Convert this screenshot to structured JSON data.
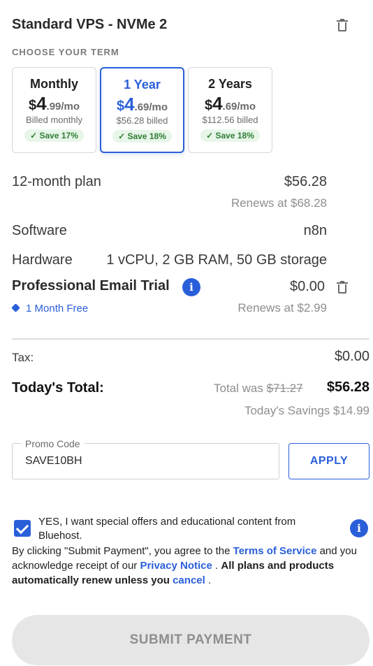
{
  "product": {
    "title": "Standard VPS - NVMe 2"
  },
  "term_section": {
    "label": "CHOOSE YOUR TERM"
  },
  "terms": [
    {
      "name": "Monthly",
      "dollar": "$",
      "price_main": "4",
      "price_cents": ".99/mo",
      "billed": "Billed monthly",
      "save": "Save 17%",
      "selected": false
    },
    {
      "name": "1 Year",
      "dollar": "$",
      "price_main": "4",
      "price_cents": ".69/mo",
      "billed": "$56.28 billed",
      "save": "Save 18%",
      "selected": true
    },
    {
      "name": "2 Years",
      "dollar": "$",
      "price_main": "4",
      "price_cents": ".69/mo",
      "billed": "$112.56 billed",
      "save": "Save 18%",
      "selected": false
    }
  ],
  "summary": {
    "plan_label": "12-month plan",
    "plan_price": "$56.28",
    "plan_renews": "Renews at $68.28",
    "software_label": "Software",
    "software_value": "n8n",
    "hardware_label": "Hardware",
    "hardware_value": "1 vCPU, 2 GB RAM, 50 GB storage",
    "email_label": "Professional Email Trial",
    "email_price": "$0.00",
    "email_tag": "1 Month Free",
    "email_renews": "Renews at $2.99"
  },
  "totals": {
    "tax_label": "Tax:",
    "tax_value": "$0.00",
    "total_label": "Today's Total:",
    "total_was_prefix": "Total was ",
    "total_was_value": "$71.27",
    "total_value": "$56.28",
    "savings": "Today's Savings $14.99"
  },
  "promo": {
    "label": "Promo Code",
    "value": "SAVE10BH",
    "apply_label": "APPLY"
  },
  "consent": {
    "checked": true,
    "offers_text": "YES, I want special offers and educational content from Bluehost.",
    "legal_1": "By clicking \"Submit Payment\", you agree to the ",
    "terms_link": "Terms of Service",
    "legal_2": " and you acknowledge receipt of our ",
    "privacy_link": "Privacy Notice",
    "legal_3": " . ",
    "legal_bold": "All plans and products automatically renew unless you",
    "cancel_link": "cancel",
    "legal_4": " ."
  },
  "submit": {
    "label": "SUBMIT PAYMENT"
  },
  "colors": {
    "accent": "#2a5fd9",
    "save_green": "#2e7d32",
    "save_bg": "#e7f6e9",
    "muted": "#8e8e8e"
  },
  "icons": {
    "delete": "trash-icon",
    "info": "info-icon",
    "tag": "tag-icon",
    "check": "check-icon"
  }
}
